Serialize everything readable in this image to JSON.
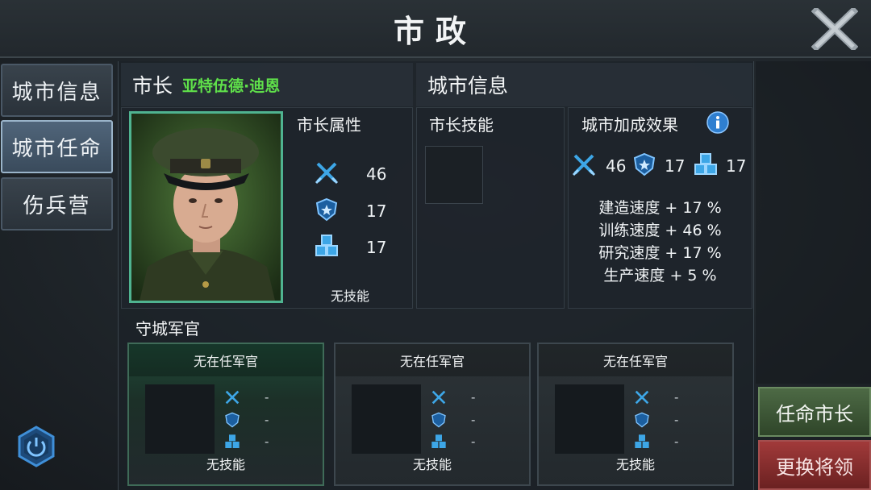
{
  "header": {
    "title": "市政",
    "close_icon": "close-icon"
  },
  "sidebar": {
    "tabs": [
      {
        "label": "城市信息",
        "active": false
      },
      {
        "label": "城市任命",
        "active": true
      },
      {
        "label": "伤兵营",
        "active": false
      }
    ],
    "power_icon": "power-icon"
  },
  "mayor": {
    "label": "市长",
    "name": "亚特伍德·迪恩",
    "attributes_title": "市长属性",
    "stats": {
      "attack": "46",
      "defense": "17",
      "resource": "17"
    },
    "skill_text": "无技能"
  },
  "city_info": {
    "label": "城市信息",
    "skill_title": "市长技能",
    "bonus_title": "城市加成效果",
    "bonus_stats": {
      "attack": "46",
      "defense": "17",
      "resource": "17"
    },
    "bonuses": [
      "建造速度 + 17 %",
      "训练速度 + 46 %",
      "研究速度 + 17 %",
      "生产速度 + 5 %"
    ]
  },
  "garrison": {
    "title": "守城军官",
    "officers": [
      {
        "title": "无在任军官",
        "attack": "-",
        "defense": "-",
        "resource": "-",
        "skill": "无技能"
      },
      {
        "title": "无在任军官",
        "attack": "-",
        "defense": "-",
        "resource": "-",
        "skill": "无技能"
      },
      {
        "title": "无在任军官",
        "attack": "-",
        "defense": "-",
        "resource": "-",
        "skill": "无技能"
      }
    ]
  },
  "actions": {
    "appoint": "任命市长",
    "change": "更换将领"
  },
  "colors": {
    "accent_green": "#5fe04a",
    "icon_blue": "#3da6e6",
    "danger_red": "#a13a3a"
  }
}
